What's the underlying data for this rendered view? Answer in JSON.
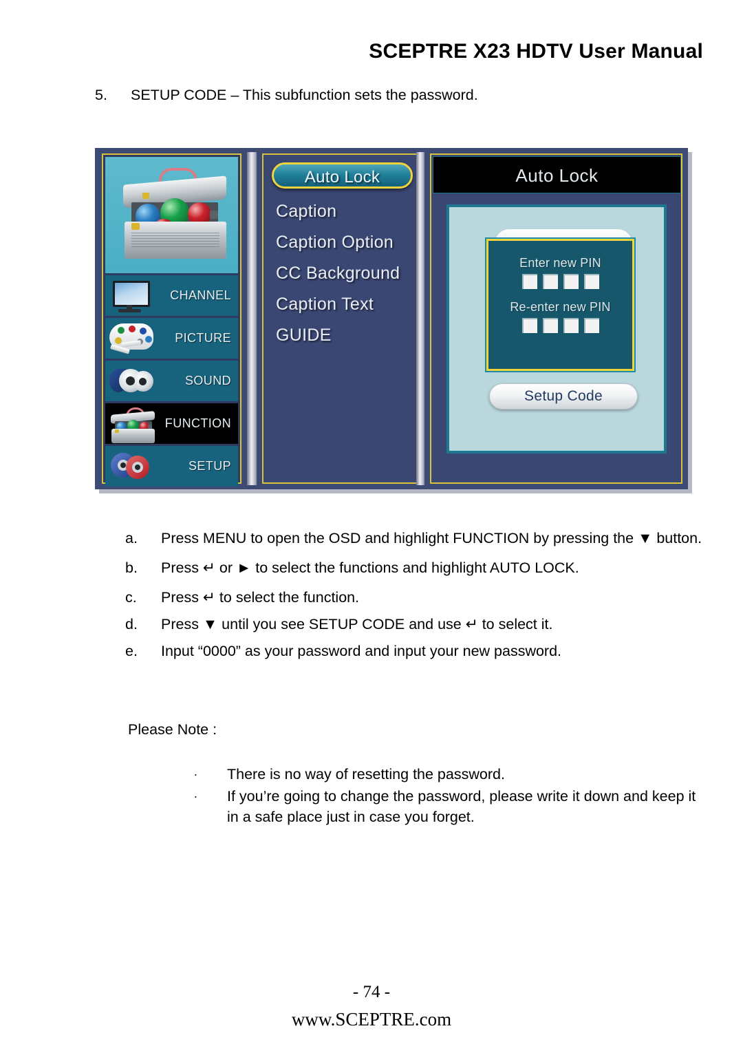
{
  "header": {
    "title": "SCEPTRE X23 HDTV User Manual"
  },
  "intro": {
    "number": "5.",
    "text": "SETUP CODE – This subfunction sets the password."
  },
  "osd": {
    "sidebar": {
      "featured_icon": "toolbox-icon",
      "items": [
        {
          "label": "CHANNEL",
          "icon": "tv-icon",
          "selected": false
        },
        {
          "label": "PICTURE",
          "icon": "palette-icon",
          "selected": false
        },
        {
          "label": "SOUND",
          "icon": "speaker-icon",
          "selected": false
        },
        {
          "label": "FUNCTION",
          "icon": "toolbox-icon",
          "selected": true
        },
        {
          "label": "SETUP",
          "icon": "gears-icon",
          "selected": false
        }
      ]
    },
    "menu": {
      "items": [
        {
          "label": "Auto Lock",
          "selected": true
        },
        {
          "label": "Caption",
          "selected": false
        },
        {
          "label": "Caption Option",
          "selected": false
        },
        {
          "label": "CC Background",
          "selected": false
        },
        {
          "label": "Caption Text",
          "selected": false
        },
        {
          "label": "GUIDE",
          "selected": false
        }
      ]
    },
    "dialog": {
      "title": "Auto Lock",
      "enter_pin_label": "Enter new PIN",
      "reenter_pin_label": "Re-enter new PIN",
      "pin_slot_count": 4,
      "setup_code_button": "Setup Code"
    },
    "colors": {
      "frame_blue": "#3d4a74",
      "highlight_yellow": "#f0d43c",
      "teal": "#16576b",
      "panel_blue": "#3a4773",
      "light_blue": "#b9d7dd"
    }
  },
  "steps": [
    {
      "label": "a.",
      "text": "Press MENU to open the OSD and highlight FUNCTION by pressing the ▼ button."
    },
    {
      "label": "b.",
      "text": "Press ↵ or ► to select the functions and highlight AUTO LOCK."
    },
    {
      "label": "c.",
      "text": "Press ↵ to select the function."
    },
    {
      "label": "d.",
      "text": "Press ▼ until you see SETUP CODE and use ↵ to select it."
    },
    {
      "label": "e.",
      "text": "Input “0000” as your password and input your new password."
    }
  ],
  "note": {
    "heading": "Please Note :",
    "bullet_glyph": "∙",
    "items": [
      "There is no way of resetting the password.",
      "If you’re going to change the password, please write it down and keep it in a safe place just in case you forget."
    ]
  },
  "footer": {
    "page_number": "- 74 -",
    "website": "www.SCEPTRE.com"
  }
}
